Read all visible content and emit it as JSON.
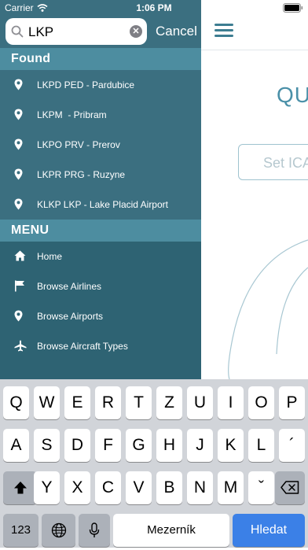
{
  "status_bar": {
    "carrier": "Carrier",
    "time": "1:06 PM"
  },
  "search": {
    "query": "LKP",
    "cancel_label": "Cancel"
  },
  "found": {
    "header": "Found",
    "items": [
      {
        "label": "LKPD PED - Pardubice",
        "icon": "location-pin-icon"
      },
      {
        "label": "LKPM  - Pribram",
        "icon": "location-pin-icon"
      },
      {
        "label": "LKPO PRV - Prerov",
        "icon": "location-pin-icon"
      },
      {
        "label": "LKPR PRG - Ruzyne",
        "icon": "location-pin-icon"
      },
      {
        "label": "KLKP LKP - Lake Placid Airport",
        "icon": "location-pin-icon"
      }
    ]
  },
  "menu": {
    "header": "MENU",
    "items": [
      {
        "label": "Home",
        "icon": "home-icon"
      },
      {
        "label": "Browse Airlines",
        "icon": "flag-icon"
      },
      {
        "label": "Browse Airports",
        "icon": "location-pin-icon"
      },
      {
        "label": "Browse Aircraft Types",
        "icon": "airplane-icon"
      }
    ]
  },
  "main": {
    "heading": "QU",
    "icao_placeholder": "Set ICA"
  },
  "keyboard": {
    "row1": [
      "Q",
      "W",
      "E",
      "R",
      "T",
      "Z",
      "U",
      "I",
      "O",
      "P"
    ],
    "row2": [
      "A",
      "S",
      "D",
      "F",
      "G",
      "H",
      "J",
      "K",
      "L",
      "´"
    ],
    "row3": [
      "Y",
      "X",
      "C",
      "V",
      "B",
      "N",
      "M",
      "ˇ"
    ],
    "numbers_label": "123",
    "space_label": "Mezerník",
    "enter_label": "Hledat"
  },
  "colors": {
    "drawer": "#3b6f80",
    "section_header": "#4d8da0",
    "menu_rows": "#2e6373",
    "accent": "#4a90a8",
    "enter_key": "#3b80e7"
  }
}
